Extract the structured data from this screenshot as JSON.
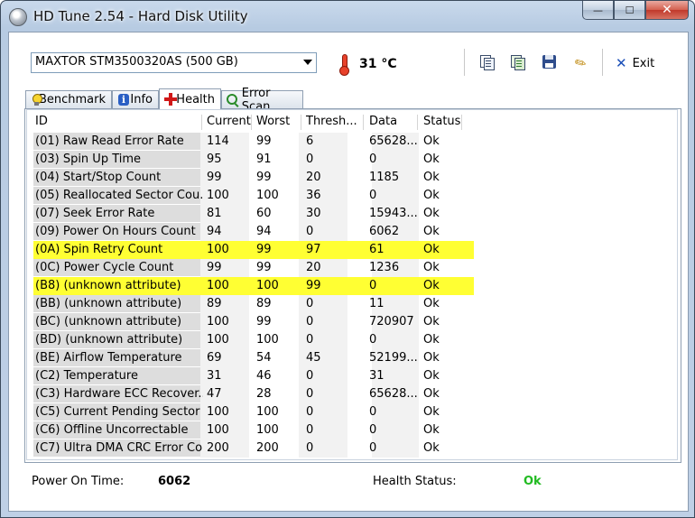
{
  "window": {
    "title": "HD Tune 2.54 - Hard Disk Utility",
    "buttons": {
      "minimize": "—",
      "maximize": "☐",
      "close": "✕"
    }
  },
  "toolbar": {
    "drive": "MAXTOR STM3500320AS (500 GB)",
    "temperature": "31 °C",
    "exit_label": "Exit",
    "icons": [
      "copy-text-icon",
      "copy-screenshot-icon",
      "save-icon",
      "options-icon"
    ]
  },
  "tabs": [
    {
      "label": "Benchmark",
      "icon": "benchmark-bulb-icon"
    },
    {
      "label": "Info",
      "icon": "info-icon"
    },
    {
      "label": "Health",
      "icon": "health-cross-icon",
      "active": true
    },
    {
      "label": "Error Scan",
      "icon": "magnifier-icon"
    }
  ],
  "table": {
    "headers": [
      "ID",
      "Current",
      "Worst",
      "Thresh...",
      "Data",
      "Status"
    ],
    "rows": [
      {
        "id": "(01) Raw Read Error Rate",
        "current": "114",
        "worst": "99",
        "threshold": "6",
        "data": "65628...",
        "status": "Ok",
        "highlight": false
      },
      {
        "id": "(03) Spin Up Time",
        "current": "95",
        "worst": "91",
        "threshold": "0",
        "data": "0",
        "status": "Ok",
        "highlight": false
      },
      {
        "id": "(04) Start/Stop Count",
        "current": "99",
        "worst": "99",
        "threshold": "20",
        "data": "1185",
        "status": "Ok",
        "highlight": false
      },
      {
        "id": "(05) Reallocated Sector Cou...",
        "current": "100",
        "worst": "100",
        "threshold": "36",
        "data": "0",
        "status": "Ok",
        "highlight": false
      },
      {
        "id": "(07) Seek Error Rate",
        "current": "81",
        "worst": "60",
        "threshold": "30",
        "data": "15943...",
        "status": "Ok",
        "highlight": false
      },
      {
        "id": "(09) Power On Hours Count",
        "current": "94",
        "worst": "94",
        "threshold": "0",
        "data": "6062",
        "status": "Ok",
        "highlight": false
      },
      {
        "id": "(0A) Spin Retry Count",
        "current": "100",
        "worst": "99",
        "threshold": "97",
        "data": "61",
        "status": "Ok",
        "highlight": true
      },
      {
        "id": "(0C) Power Cycle Count",
        "current": "99",
        "worst": "99",
        "threshold": "20",
        "data": "1236",
        "status": "Ok",
        "highlight": false
      },
      {
        "id": "(B8) (unknown attribute)",
        "current": "100",
        "worst": "100",
        "threshold": "99",
        "data": "0",
        "status": "Ok",
        "highlight": true
      },
      {
        "id": "(BB) (unknown attribute)",
        "current": "89",
        "worst": "89",
        "threshold": "0",
        "data": "11",
        "status": "Ok",
        "highlight": false
      },
      {
        "id": "(BC) (unknown attribute)",
        "current": "100",
        "worst": "99",
        "threshold": "0",
        "data": "720907",
        "status": "Ok",
        "highlight": false
      },
      {
        "id": "(BD) (unknown attribute)",
        "current": "100",
        "worst": "100",
        "threshold": "0",
        "data": "0",
        "status": "Ok",
        "highlight": false
      },
      {
        "id": "(BE) Airflow Temperature",
        "current": "69",
        "worst": "54",
        "threshold": "45",
        "data": "52199...",
        "status": "Ok",
        "highlight": false
      },
      {
        "id": "(C2) Temperature",
        "current": "31",
        "worst": "46",
        "threshold": "0",
        "data": "31",
        "status": "Ok",
        "highlight": false
      },
      {
        "id": "(C3) Hardware ECC Recover...",
        "current": "47",
        "worst": "28",
        "threshold": "0",
        "data": "65628...",
        "status": "Ok",
        "highlight": false
      },
      {
        "id": "(C5) Current Pending Sector",
        "current": "100",
        "worst": "100",
        "threshold": "0",
        "data": "0",
        "status": "Ok",
        "highlight": false
      },
      {
        "id": "(C6) Offline Uncorrectable",
        "current": "100",
        "worst": "100",
        "threshold": "0",
        "data": "0",
        "status": "Ok",
        "highlight": false
      },
      {
        "id": "(C7) Ultra DMA CRC Error Co...",
        "current": "200",
        "worst": "200",
        "threshold": "0",
        "data": "0",
        "status": "Ok",
        "highlight": false
      }
    ]
  },
  "footer": {
    "power_on_label": "Power On Time:",
    "power_on_value": "6062",
    "health_label": "Health Status:",
    "health_value": "Ok"
  },
  "colors": {
    "highlight": "#ffff33",
    "ok_green": "#22bb22"
  }
}
